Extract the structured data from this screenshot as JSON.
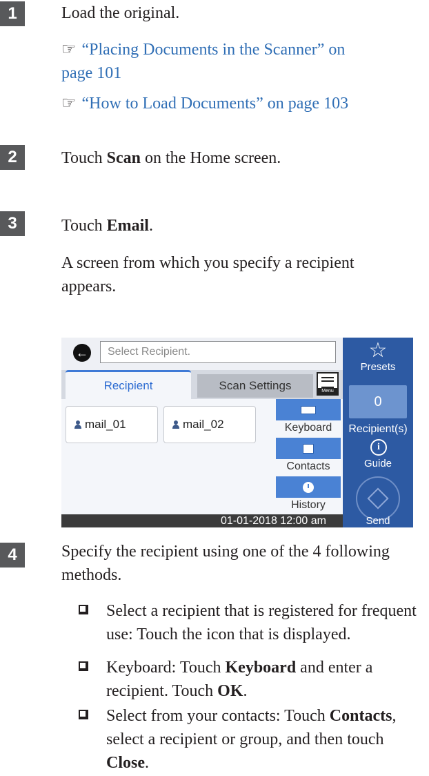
{
  "steps": [
    {
      "number": "1",
      "text": "Load the original.",
      "refs": [
        {
          "icon": "☞",
          "link_line1": "“Placing Documents in the Scanner” on",
          "link_line2": "page 101"
        },
        {
          "icon": "☞",
          "link": "“How to Load Documents” on page 103"
        }
      ]
    },
    {
      "number": "2",
      "pre": "Touch ",
      "bold": "Scan",
      "post": " on the Home screen."
    },
    {
      "number": "3",
      "pre": "Touch ",
      "bold": "Email",
      "post": ".",
      "desc_line1": "A screen from which you specify a recipient",
      "desc_line2": "appears."
    },
    {
      "number": "4",
      "line1": "Specify the recipient using one of the 4 following",
      "line2": "methods."
    }
  ],
  "device": {
    "search_placeholder": "Select Recipient.",
    "tabs": {
      "active": "Recipient",
      "inactive": "Scan Settings",
      "menu": "Menu"
    },
    "recipients": [
      "mail_01",
      "mail_02"
    ],
    "options": {
      "keyboard": "Keyboard",
      "contacts": "Contacts",
      "history": "History"
    },
    "status_time": "01-01-2018 12:00 am",
    "right_panel": {
      "presets": "Presets",
      "count": "0",
      "recipients_label": "Recipient(s)",
      "guide": "Guide",
      "send": "Send"
    }
  },
  "bullets": [
    {
      "line1": "Select a recipient that is registered for frequent",
      "line2": "use: Touch the icon that is displayed."
    },
    {
      "l1_pre": "Keyboard: Touch ",
      "l1_bold": "Keyboard",
      "l1_post": " and enter a",
      "l2_pre": "recipient. Touch ",
      "l2_bold": "OK",
      "l2_post": "."
    },
    {
      "l1_pre": "Select from your contacts: Touch ",
      "l1_bold": "Contacts",
      "l1_post": ",",
      "line2": "select a recipient or group, and then touch",
      "l3_bold": "Close",
      "l3_post": "."
    }
  ]
}
